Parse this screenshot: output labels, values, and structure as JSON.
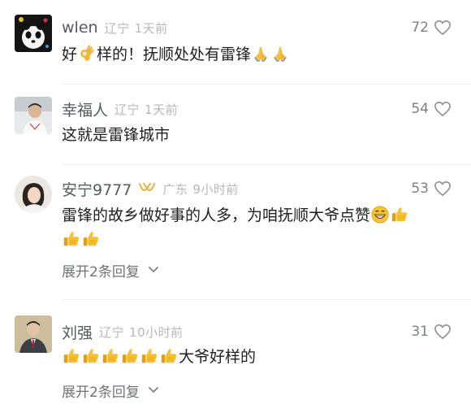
{
  "comments": [
    {
      "name": "wlen",
      "location": "辽宁",
      "time": "1天前",
      "likes": "72",
      "avatar_icon": "panda-avatar",
      "text_parts": [
        "好",
        "样的！抚顺处处有雷锋"
      ],
      "inline_emojis": [
        "ok-hand-emoji",
        "pray-emoji",
        "pray-emoji"
      ]
    },
    {
      "name": "幸福人",
      "location": "辽宁",
      "time": "1天前",
      "likes": "54",
      "avatar_icon": "man-photo-avatar",
      "text": "这就是雷锋城市"
    },
    {
      "name": "安宁9777",
      "location": "广东",
      "time": "9小时前",
      "likes": "53",
      "avatar_icon": "woman-photo-avatar",
      "badge_icon": "vip-badge-icon",
      "text": "雷锋的故乡做好事的人多，为咱抚顺大爷点赞",
      "inline_emojis": [
        "grin-emoji",
        "thumbs-up-emoji",
        "thumbs-up-emoji",
        "thumbs-up-emoji"
      ],
      "expand_label": "展开2条回复"
    },
    {
      "name": "刘强",
      "location": "辽宁",
      "time": "10小时前",
      "likes": "31",
      "avatar_icon": "man-portrait-avatar",
      "text": "大爷好样的",
      "inline_emojis": [
        "thumbs-up-emoji",
        "thumbs-up-emoji",
        "thumbs-up-emoji",
        "thumbs-up-emoji",
        "thumbs-up-emoji",
        "thumbs-up-emoji"
      ],
      "expand_label": "展开2条回复"
    }
  ],
  "colors": {
    "name": "#555a62",
    "meta": "#b4b7bc",
    "text": "#1f1f1f",
    "thumb": "#f5b51f",
    "vip": "#e8b33d"
  }
}
